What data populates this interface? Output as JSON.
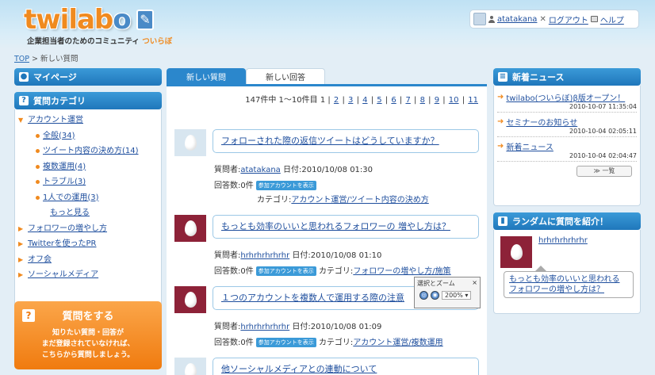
{
  "header": {
    "logo_main": "twilab",
    "logo_o": "o",
    "tagline_main": "企業担当者のためのコミュニティ",
    "tagline_kana": "ついらぼ",
    "user": "atatakana",
    "logout": "ログアウト",
    "help": "ヘルプ"
  },
  "breadcrumb": {
    "top": "TOP",
    "sep": " > ",
    "current": "新しい質問"
  },
  "sidebar": {
    "mypage": "マイページ",
    "categories_title": "質問カテゴリ",
    "cat_main": "アカウント運営",
    "sub": [
      {
        "label": "全般(34)"
      },
      {
        "label": "ツイート内容の決め方(14)"
      },
      {
        "label": "複数運用(4)"
      },
      {
        "label": "トラブル(3)"
      },
      {
        "label": "1人での運用(3)"
      }
    ],
    "more": "もっと見る",
    "others": [
      {
        "label": "フォロワーの増やし方"
      },
      {
        "label": "Twitterを使ったPR"
      },
      {
        "label": "オフ会"
      },
      {
        "label": "ソーシャルメディア"
      }
    ],
    "ask_title": "質問をする",
    "ask_line1": "知りたい質問・回答が",
    "ask_line2": "まだ登録されていなければ、",
    "ask_line3": "こちらから質問しましょう。"
  },
  "tabs": {
    "new_questions": "新しい質問",
    "new_answers": "新しい回答"
  },
  "pager": {
    "summary": "147件中 1〜10件目",
    "pages": [
      "1",
      "2",
      "3",
      "4",
      "5",
      "6",
      "7",
      "8",
      "9",
      "10",
      "11"
    ]
  },
  "labels": {
    "asker": "質問者:",
    "date": "日付:",
    "answers": "回答数:",
    "category": "カテゴリ:",
    "badge": "参加アカウントを表示"
  },
  "questions": [
    {
      "title": "フォローされた際の返信ツイートはどうしていますか？",
      "user": "atatakana",
      "date": "2010/10/08 01:30",
      "answers": "0件",
      "category": "アカウント運営/ツイート内容の決め方"
    },
    {
      "title": "もっとも効率のいいと思われるフォロワーの 増やし方は？",
      "user": "hrhrhrhrhrhr",
      "date": "2010/10/08 01:10",
      "answers": "0件",
      "category": "フォロワーの増やし方/施策"
    },
    {
      "title": "１つのアカウントを複数人で運用する際の注意",
      "user": "hrhrhrhrhrhr",
      "date": "2010/10/08 01:09",
      "answers": "0件",
      "category": "アカウント運営/複数運用"
    },
    {
      "title": "他ソーシャルメディアとの連動について"
    }
  ],
  "zoom": {
    "title": "選択とズーム",
    "close": "×",
    "level": "200%"
  },
  "news": {
    "title": "新着ニュース",
    "items": [
      {
        "label": "twilabo(ついらぼ)β版オープン！",
        "date": "2010-10-07 11:35:04"
      },
      {
        "label": "セミナーのお知らせ",
        "date": "2010-10-04 02:05:11"
      },
      {
        "label": "新着ニュース",
        "date": "2010-10-04 02:04:47"
      }
    ],
    "list_button": "≫ 一覧"
  },
  "random": {
    "title": "ランダムに質問を紹介！",
    "user": "hrhrhrhrhrhr",
    "question_line1": "もっとも効率のいいと思われる",
    "question_line2": "フォロワーの増やし方は？"
  }
}
